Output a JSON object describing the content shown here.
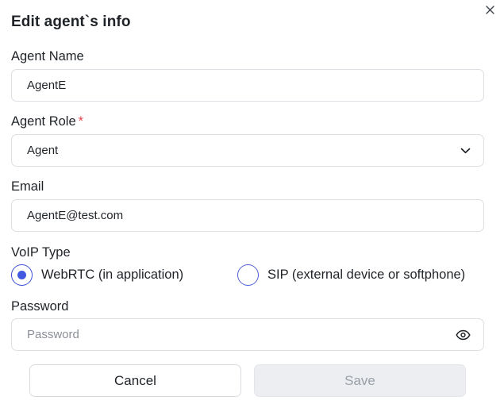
{
  "dialog": {
    "title": "Edit agent`s info",
    "close_icon": "close-icon"
  },
  "fields": {
    "agent_name": {
      "label": "Agent Name",
      "value": "AgentE"
    },
    "agent_role": {
      "label": "Agent Role",
      "required_mark": "*",
      "value": "Agent",
      "icon": "chevron-down-icon"
    },
    "email": {
      "label": "Email",
      "value": "AgentE@test.com"
    },
    "voip_type": {
      "label": "VoIP Type",
      "options": [
        {
          "label": "WebRTC (in application)",
          "selected": true
        },
        {
          "label": "SIP (external device or softphone)",
          "selected": false
        }
      ]
    },
    "password": {
      "label": "Password",
      "value": "",
      "placeholder": "Password",
      "icon": "eye-icon"
    }
  },
  "buttons": {
    "cancel_label": "Cancel",
    "save_label": "Save",
    "save_disabled": true
  },
  "colors": {
    "accent": "#4258e0",
    "required": "#e5484d",
    "disabled_bg": "#eceef1",
    "disabled_text": "#9aa0a8"
  }
}
